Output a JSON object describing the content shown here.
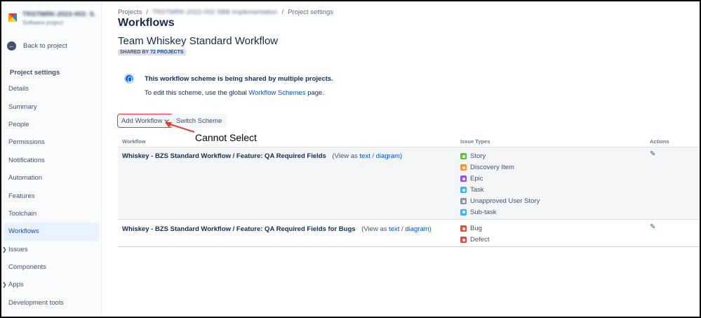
{
  "sidebar": {
    "project_name": "TRSTMRK-2022-002: S...",
    "project_type": "Software project",
    "back_label": "Back to project",
    "section_title": "Project settings",
    "items": [
      {
        "label": "Details"
      },
      {
        "label": "Summary"
      },
      {
        "label": "People"
      },
      {
        "label": "Permissions"
      },
      {
        "label": "Notifications"
      },
      {
        "label": "Automation"
      },
      {
        "label": "Features"
      },
      {
        "label": "Toolchain"
      },
      {
        "label": "Workflows",
        "active": true
      },
      {
        "label": "Issues",
        "expandable": true
      },
      {
        "label": "Components"
      },
      {
        "label": "Apps",
        "expandable": true
      },
      {
        "label": "Development tools"
      }
    ]
  },
  "breadcrumb": {
    "projects": "Projects",
    "sep1": "/",
    "project": "TRSTMRK-2022-002 SBB Implementation",
    "sep2": "/",
    "current": "Project settings"
  },
  "page_title": "Workflows",
  "scheme": {
    "title": "Team Whiskey Standard Workflow",
    "shared_prefix": "SHARED BY",
    "shared_count": "72 PROJECTS"
  },
  "info": {
    "bold": "This workflow scheme is being shared by multiple projects.",
    "line_prefix": "To edit this scheme, use the global",
    "line_link": "Workflow Schemes",
    "line_suffix": "page."
  },
  "actions": {
    "add_workflow": "Add Workflow",
    "switch_scheme": "Switch Scheme"
  },
  "annotation": "Cannot Select",
  "table": {
    "headers": {
      "workflow": "Workflow",
      "issue_types": "Issue Types",
      "actions": "Actions"
    },
    "view_as": "(View as",
    "text_link": "text",
    "slash": "/",
    "diagram_link": "diagram)",
    "rows": [
      {
        "name": "Whiskey - BZS Standard Workflow / Feature: QA Required Fields",
        "types": [
          {
            "label": "Story",
            "color": "#63ba3c"
          },
          {
            "label": "Discovery Item",
            "color": "#f79232"
          },
          {
            "label": "Epic",
            "color": "#904ee2"
          },
          {
            "label": "Task",
            "color": "#4bade8"
          },
          {
            "label": "Unapproved User Story",
            "color": "#8993a4"
          },
          {
            "label": "Sub-task",
            "color": "#4bade8"
          }
        ]
      },
      {
        "name": "Whiskey - BZS Standard Workflow / Feature: QA Required Fields for Bugs",
        "types": [
          {
            "label": "Bug",
            "color": "#e5493a"
          },
          {
            "label": "Defect",
            "color": "#e5493a"
          }
        ]
      }
    ]
  }
}
